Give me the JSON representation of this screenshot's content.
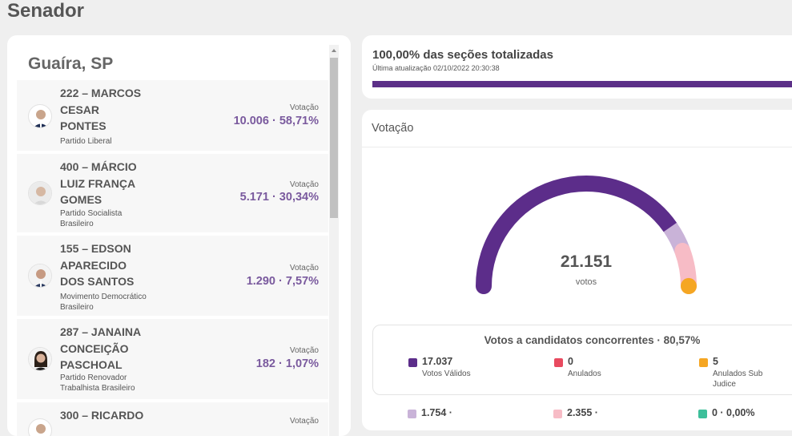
{
  "page_title": "Senador",
  "city": "Guaíra, SP",
  "candidates": [
    {
      "name": "222 – MARCOS CESAR PONTES",
      "party": "Partido Liberal",
      "vote_label": "Votação",
      "votes": "10.006 · 58,71%"
    },
    {
      "name": "400 – MÁRCIO LUIZ FRANÇA GOMES",
      "party": "Partido Socialista Brasileiro",
      "vote_label": "Votação",
      "votes": "5.171 · 30,34%"
    },
    {
      "name": "155 – EDSON APARECIDO DOS SANTOS",
      "party": "Movimento Democrático Brasileiro",
      "vote_label": "Votação",
      "votes": "1.290 · 7,57%"
    },
    {
      "name": "287 – JANAINA CONCEIÇÃO PASCHOAL",
      "party": "Partido Renovador Trabalhista Brasileiro",
      "vote_label": "Votação",
      "votes": "182 · 1,07%"
    },
    {
      "name": "300 – RICARDO",
      "party": "",
      "vote_label": "Votação",
      "votes": ""
    }
  ],
  "progress": {
    "title": "100,00% das seções totalizadas",
    "updated": "Última atualização 02/10/2022 20:30:38",
    "percent": 100
  },
  "votes_panel": {
    "header": "Votação",
    "total": "21.151",
    "total_unit": "votos",
    "gauge_segments": [
      {
        "name": "valid",
        "value": 17037,
        "color": "#5c2d8a"
      },
      {
        "name": "blank",
        "value": 1754,
        "color": "#c9b3d8"
      },
      {
        "name": "null",
        "value": 2355,
        "color": "#f7bcc6"
      },
      {
        "name": "sub_judice",
        "value": 5,
        "color": "#f5a623"
      }
    ],
    "summary_title": "Votos a candidatos concorrentes · 80,57%",
    "stats": [
      {
        "value": "17.037",
        "label": "Votos Válidos",
        "color": "#5c2d8a"
      },
      {
        "value": "0",
        "label": "Anulados",
        "color": "#e84a5f"
      },
      {
        "value": "5",
        "label": "Anulados Sub Judice",
        "color": "#f5a623"
      },
      {
        "value": "1.754 ·",
        "label": "",
        "color": "#c9b3d8"
      },
      {
        "value": "2.355 ·",
        "label": "",
        "color": "#f7bcc6"
      },
      {
        "value": "0 · 0,00%",
        "label": "",
        "color": "#3dbf9a"
      }
    ]
  }
}
